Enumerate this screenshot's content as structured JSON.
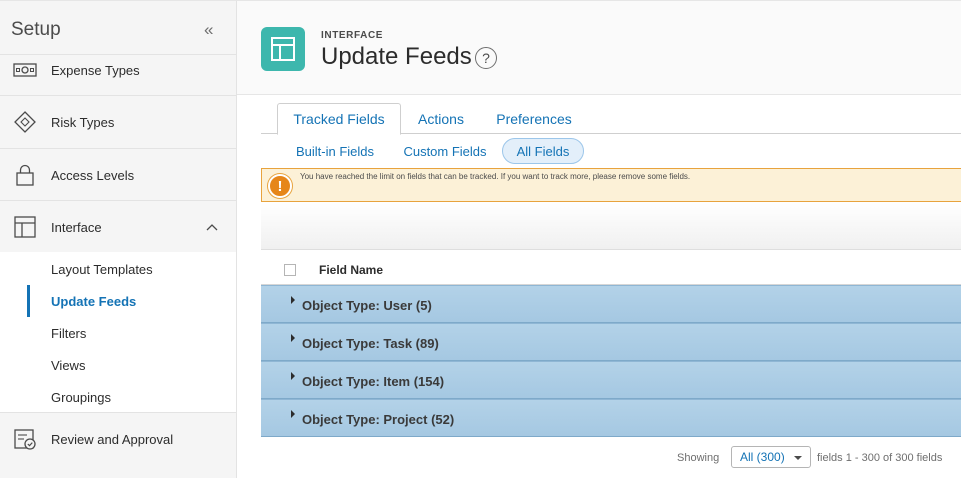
{
  "sidebar": {
    "title": "Setup",
    "collapse_icon": "«",
    "items": [
      {
        "label": "Expense Types",
        "icon": "expense-icon"
      },
      {
        "label": "Risk Types",
        "icon": "risk-icon"
      },
      {
        "label": "Access Levels",
        "icon": "lock-icon"
      },
      {
        "label": "Interface",
        "icon": "layout-icon"
      },
      {
        "label": "Review and Approval",
        "icon": "review-icon"
      }
    ],
    "interface_sub": [
      {
        "label": "Layout Templates"
      },
      {
        "label": "Update Feeds"
      },
      {
        "label": "Filters"
      },
      {
        "label": "Views"
      },
      {
        "label": "Groupings"
      }
    ]
  },
  "header": {
    "eyebrow": "INTERFACE",
    "title": "Update Feeds",
    "help": "?"
  },
  "tabs": [
    {
      "label": "Tracked Fields",
      "active": true
    },
    {
      "label": "Actions",
      "active": false
    },
    {
      "label": "Preferences",
      "active": false
    }
  ],
  "subtabs": [
    {
      "label": "Built-in Fields",
      "active": false
    },
    {
      "label": "Custom Fields",
      "active": false
    },
    {
      "label": "All Fields",
      "active": true
    }
  ],
  "warning": {
    "icon": "!",
    "text": "You have reached the limit on fields that can be tracked. If you want to track more, please remove some fields."
  },
  "grid": {
    "column_header": "Field Name",
    "groups": [
      {
        "label": "Object Type: User (5)"
      },
      {
        "label": "Object Type: Task (89)"
      },
      {
        "label": "Object Type: Item (154)"
      },
      {
        "label": "Object Type: Project (52)"
      }
    ]
  },
  "footer": {
    "showing": "Showing",
    "select_value": "All (300)",
    "range": "fields 1 - 300 of 300 fields"
  },
  "colors": {
    "accent": "#1473b5",
    "brand_icon_bg": "#3db7ad",
    "warning_bg": "#fcf1d7",
    "warning_icon": "#e68619",
    "group_row": "#a5c8e2"
  }
}
